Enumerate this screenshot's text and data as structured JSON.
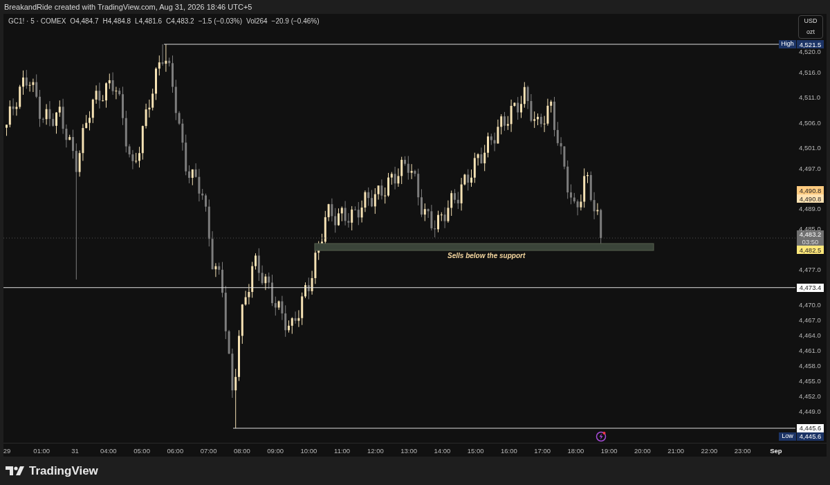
{
  "header": {
    "title": "BreakandRide created with TradingView.com, Aug 31, 2026 18:46 UTC+5"
  },
  "legend": {
    "symbol": "GC1! · 5 · COMEX",
    "open": "O4,484.7",
    "high": "H4,484.8",
    "low": "L4,481.6",
    "close": "C4,483.2",
    "change": "−1.5 (−0.03%)",
    "volume": "Vol264",
    "volume_change": "−20.9 (−0.46%)"
  },
  "unit_box": {
    "currency": "USD",
    "unit": "ozt"
  },
  "price_scale": [
    "4,520.0",
    "4,516.0",
    "4,511.0",
    "4,506.0",
    "4,501.0",
    "4,497.0",
    "4,489.0",
    "4,485.0",
    "4,477.0",
    "4,470.0",
    "4,467.0",
    "4,464.0",
    "4,461.0",
    "4,458.0",
    "4,455.0",
    "4,452.0",
    "4,449.0"
  ],
  "price_labels": [
    {
      "kind": "high",
      "caption": "High",
      "value": "4,521.5"
    },
    {
      "kind": "alert",
      "value": "4,490.8"
    },
    {
      "kind": "alert_light",
      "value": "4,490.8"
    },
    {
      "kind": "last",
      "value": "4,483.2",
      "countdown": "03:50"
    },
    {
      "kind": "bid",
      "value": "4,482.5"
    },
    {
      "kind": "line",
      "value": "4,473.4"
    },
    {
      "kind": "level",
      "value": "4,445.6"
    },
    {
      "kind": "low",
      "caption": "Low",
      "value": "4,445.6"
    }
  ],
  "annotation": {
    "text": "Sells below the support"
  },
  "time_axis": [
    "29",
    "01:00",
    "31",
    "04:00",
    "05:00",
    "06:00",
    "07:00",
    "08:00",
    "09:00",
    "10:00",
    "11:00",
    "12:00",
    "13:00",
    "14:00",
    "15:00",
    "16:00",
    "17:00",
    "18:00",
    "19:00",
    "20:00",
    "21:00",
    "22:00",
    "23:00",
    "Sep"
  ],
  "footer": {
    "brand": "TradingView"
  }
}
